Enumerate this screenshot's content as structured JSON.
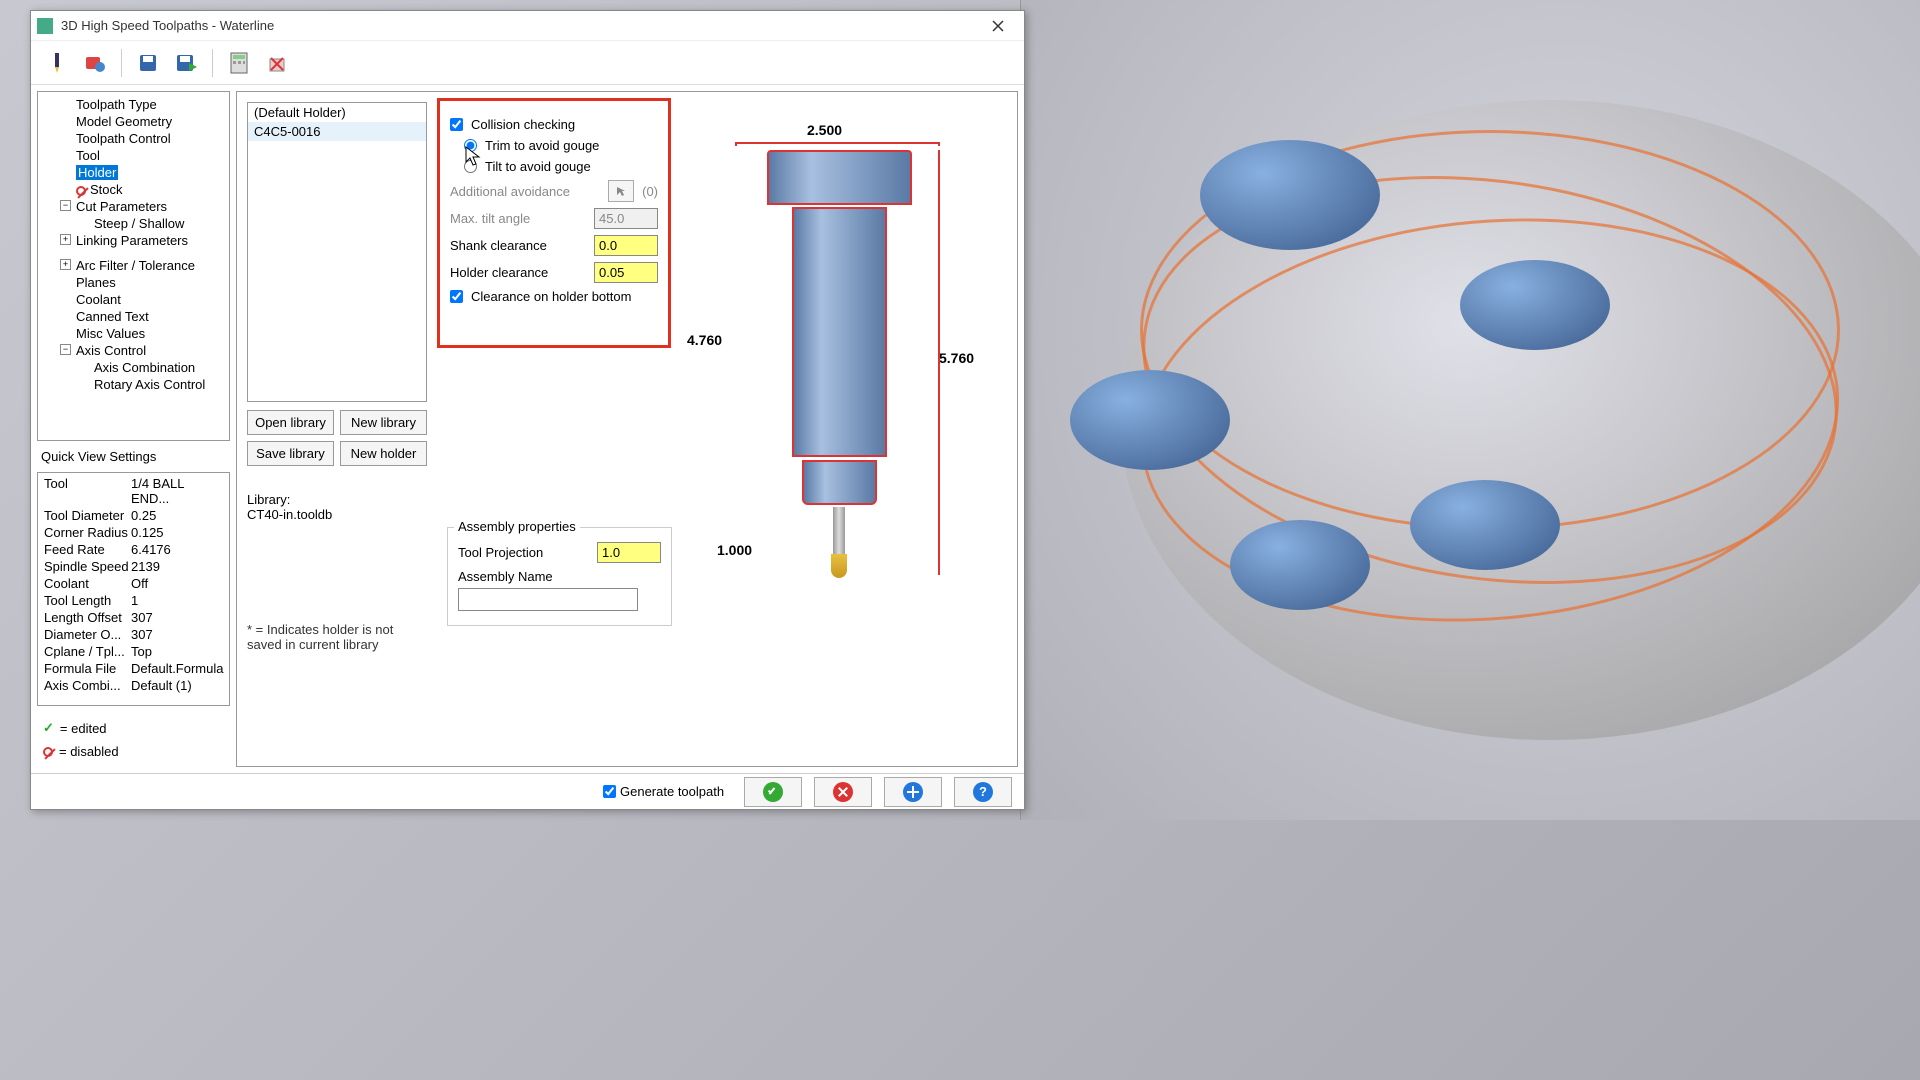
{
  "window": {
    "title": "3D High Speed Toolpaths - Waterline"
  },
  "tree": {
    "items": [
      "Toolpath Type",
      "Model Geometry",
      "Toolpath Control",
      "Tool",
      "Holder",
      "Stock",
      "Cut Parameters",
      "Steep / Shallow",
      "Linking Parameters",
      "Arc Filter / Tolerance",
      "Planes",
      "Coolant",
      "Canned Text",
      "Misc Values",
      "Axis Control",
      "Axis Combination",
      "Rotary Axis Control"
    ],
    "selected": "Holder",
    "disabled": "Stock"
  },
  "quickview": {
    "title": "Quick View Settings",
    "rows": [
      {
        "k": "Tool",
        "v": "1/4 BALL END..."
      },
      {
        "k": "Tool Diameter",
        "v": "0.25"
      },
      {
        "k": "Corner Radius",
        "v": "0.125"
      },
      {
        "k": "Feed Rate",
        "v": "6.4176"
      },
      {
        "k": "Spindle Speed",
        "v": "2139"
      },
      {
        "k": "Coolant",
        "v": "Off"
      },
      {
        "k": "Tool Length",
        "v": "1"
      },
      {
        "k": "Length Offset",
        "v": "307"
      },
      {
        "k": "Diameter O...",
        "v": "307"
      },
      {
        "k": "Cplane / Tpl...",
        "v": "Top"
      },
      {
        "k": "Formula File",
        "v": "Default.Formula"
      },
      {
        "k": "Axis Combi...",
        "v": "Default (1)"
      }
    ]
  },
  "legend": {
    "edited": "= edited",
    "disabled": "= disabled"
  },
  "holderlist": {
    "items": [
      "(Default Holder)",
      "C4C5-0016"
    ],
    "selected": 1
  },
  "buttons": {
    "open_library": "Open library",
    "new_library": "New library",
    "save_library": "Save library",
    "new_holder": "New holder"
  },
  "library": {
    "label": "Library:",
    "value": "CT40-in.tooldb"
  },
  "note": "* = Indicates holder is not saved in current library",
  "collision": {
    "check_label": "Collision checking",
    "trim_label": "Trim to avoid gouge",
    "tilt_label": "Tilt to avoid gouge",
    "addl_label": "Additional avoidance",
    "addl_count": "(0)",
    "max_tilt_label": "Max. tilt angle",
    "max_tilt_value": "45.0",
    "shank_label": "Shank clearance",
    "shank_value": "0.0",
    "holder_label": "Holder clearance",
    "holder_value": "0.05",
    "bottom_label": "Clearance on holder bottom"
  },
  "assembly": {
    "legend": "Assembly properties",
    "proj_label": "Tool Projection",
    "proj_value": "1.0",
    "name_label": "Assembly Name",
    "name_value": ""
  },
  "dims": {
    "top": "2.500",
    "left": "4.760",
    "right": "5.760",
    "bottom": "1.000"
  },
  "footer": {
    "generate": "Generate toolpath"
  }
}
